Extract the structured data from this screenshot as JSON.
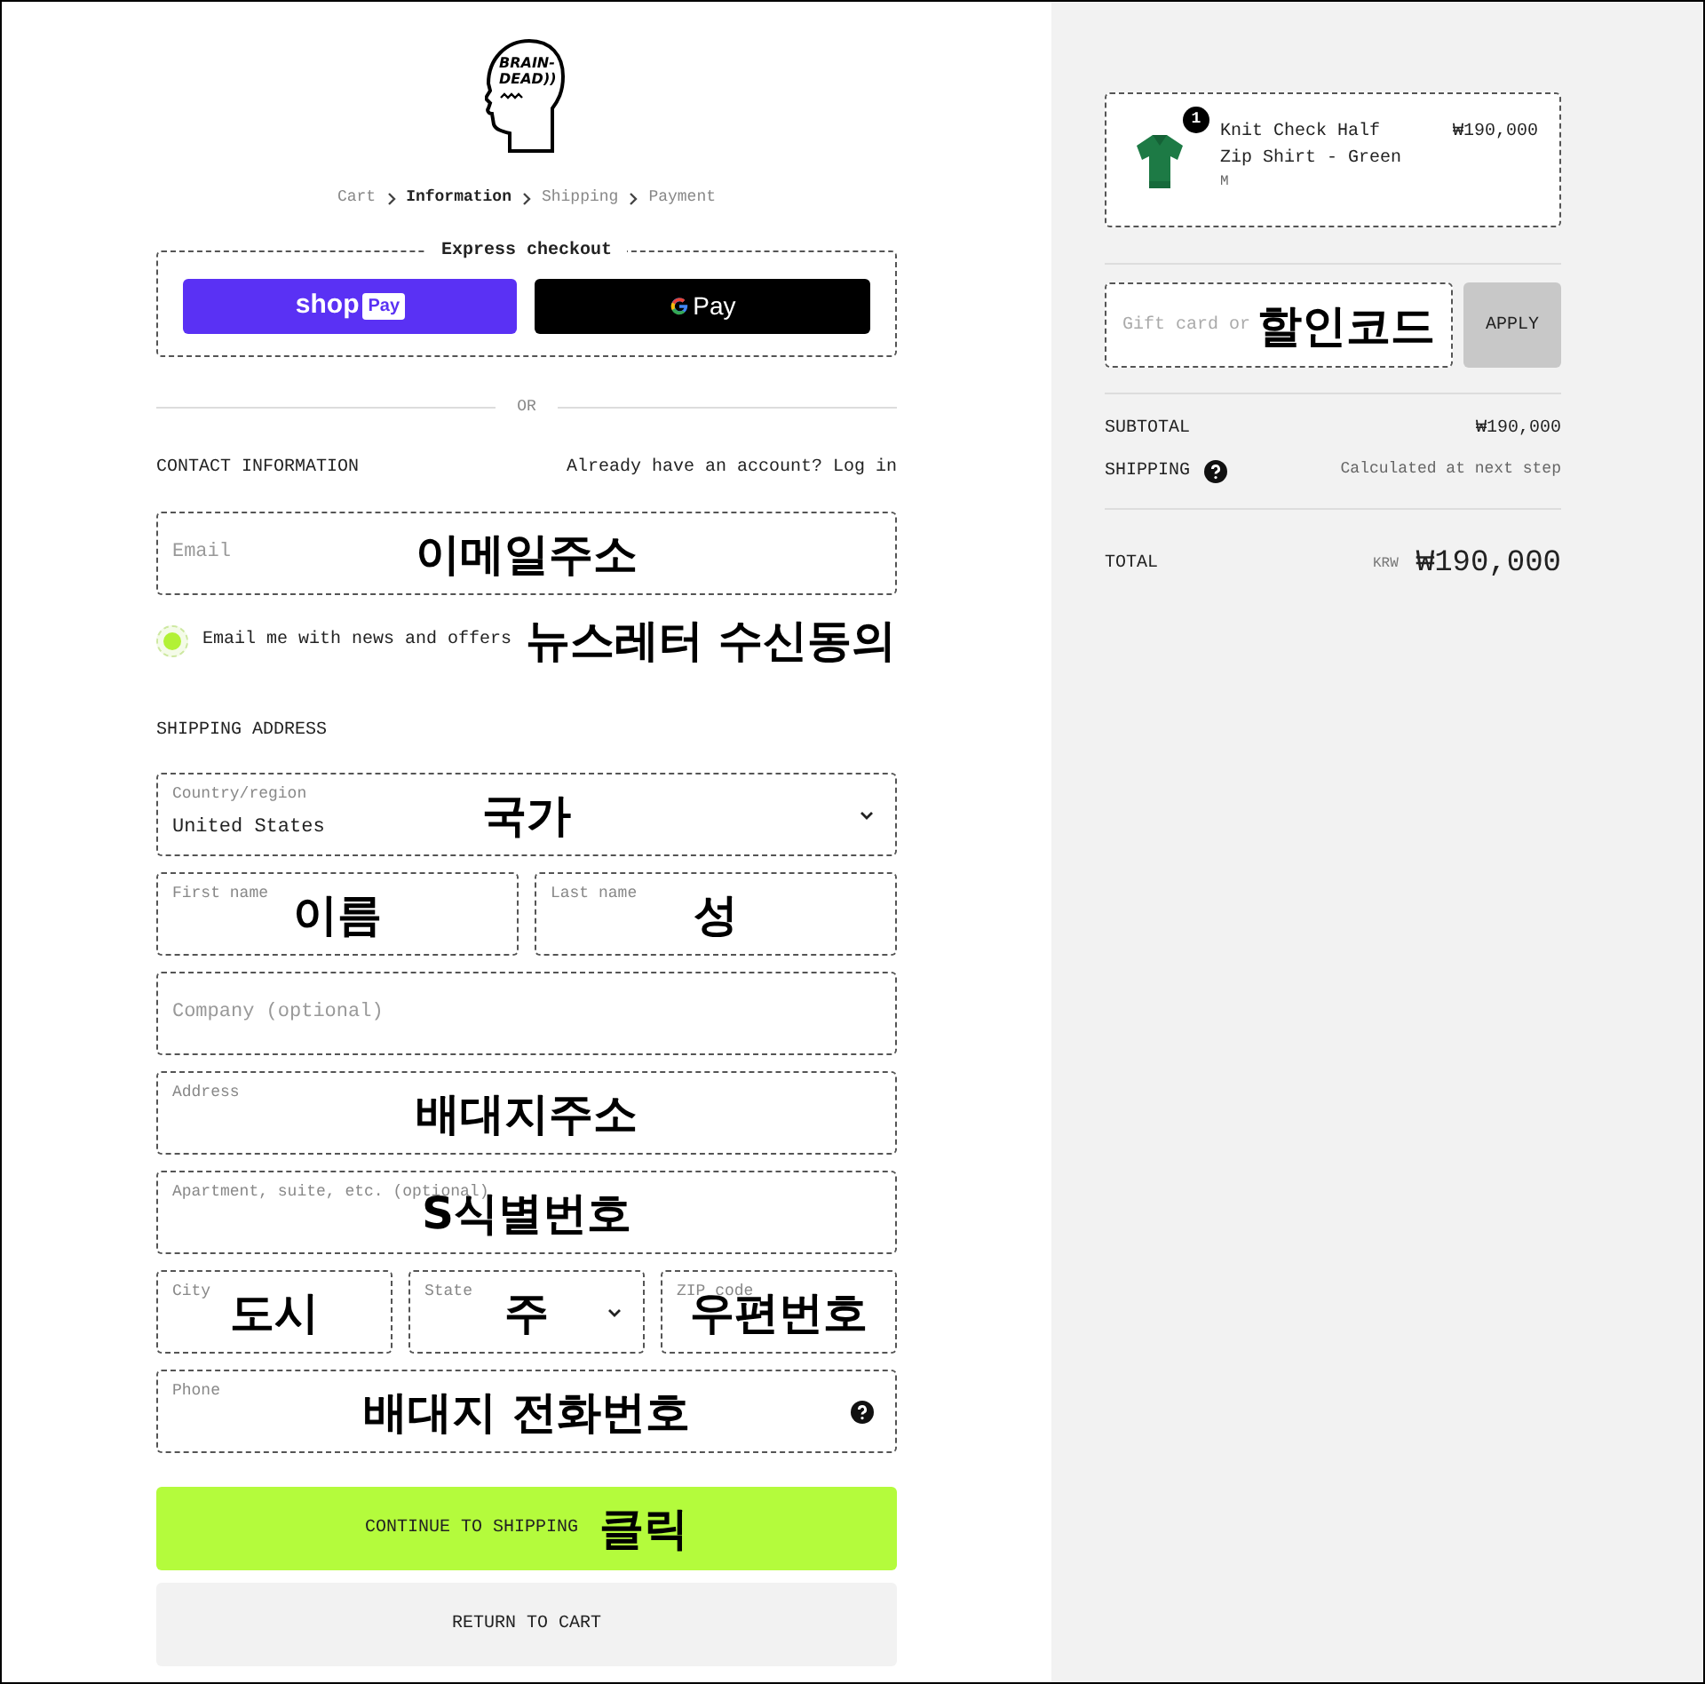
{
  "logo": {
    "text_lines": [
      "BRAIN-",
      "DEAD))"
    ]
  },
  "breadcrumbs": [
    {
      "label": "Cart",
      "selected": false
    },
    {
      "label": "Information",
      "selected": true
    },
    {
      "label": "Shipping",
      "selected": false
    },
    {
      "label": "Payment",
      "selected": false
    }
  ],
  "express_checkout": {
    "title": "Express checkout",
    "buttons": [
      {
        "kind": "shop_pay",
        "label": "shop",
        "badge": "Pay"
      },
      {
        "kind": "google_pay",
        "label": "Pay"
      }
    ]
  },
  "divider_label": "OR",
  "contact": {
    "heading": "CONTACT INFORMATION",
    "account_prompt": "Already have an account?",
    "login_link": "Log in",
    "email": {
      "placeholder": "Email",
      "annotation": "이메일주소"
    },
    "newsletter": {
      "label": "Email me with news and offers",
      "checked": true,
      "annotation": "뉴스레터 수신동의"
    }
  },
  "shipping": {
    "heading": "SHIPPING ADDRESS",
    "rows": [
      {
        "fields": [
          {
            "kind": "select",
            "label": "Country/region",
            "value": "United States",
            "annotation": "국가"
          }
        ]
      },
      {
        "fields": [
          {
            "kind": "text",
            "label": "First name",
            "annotation": "이름"
          },
          {
            "kind": "text",
            "label": "Last name",
            "annotation": "성"
          }
        ]
      },
      {
        "fields": [
          {
            "kind": "plain",
            "placeholder": "Company (optional)"
          }
        ]
      },
      {
        "fields": [
          {
            "kind": "text",
            "label": "Address",
            "annotation": "배대지주소"
          }
        ]
      },
      {
        "fields": [
          {
            "kind": "text",
            "label": "Apartment, suite, etc. (optional)",
            "annotation": "S식별번호"
          }
        ]
      },
      {
        "fields": [
          {
            "kind": "text",
            "label": "City",
            "annotation": "도시"
          },
          {
            "kind": "select",
            "label": "State",
            "annotation": "주"
          },
          {
            "kind": "text",
            "label": "ZIP code",
            "annotation": "우편번호"
          }
        ]
      },
      {
        "fields": [
          {
            "kind": "text",
            "label": "Phone",
            "annotation": "배대지 전화번호",
            "help_icon": true
          }
        ]
      }
    ]
  },
  "actions": [
    {
      "kind": "primary",
      "label": "CONTINUE TO SHIPPING",
      "annotation": "클릭"
    },
    {
      "kind": "secondary",
      "label": "RETURN TO CART"
    }
  ],
  "summary": {
    "items": [
      {
        "kind": "picture",
        "quantity": "1",
        "name": "Knit Check Half Zip Shirt - Green",
        "variant": "M",
        "price": "₩190,000"
      }
    ],
    "discount": {
      "placeholder": "Gift card or",
      "annotation": "할인코드",
      "button": "APPLY"
    },
    "lines": [
      {
        "label": "SUBTOTAL",
        "value": "₩190,000"
      },
      {
        "label": "SHIPPING",
        "value": "Calculated at next step",
        "help_icon": true
      }
    ],
    "total": {
      "label": "TOTAL",
      "currency": "KRW",
      "value": "₩190,000"
    }
  }
}
